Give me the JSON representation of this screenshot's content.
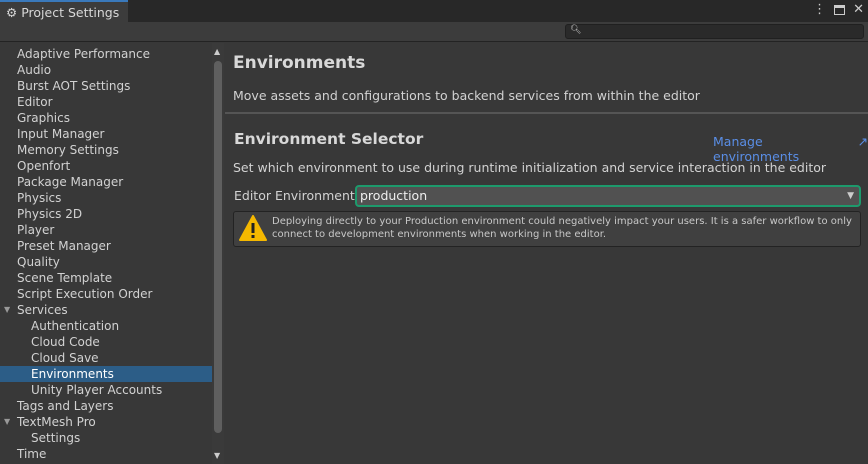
{
  "window": {
    "tab_title": "Project Settings",
    "search_placeholder": ""
  },
  "sidebar": {
    "items": [
      {
        "label": "Adaptive Performance",
        "indent": 0
      },
      {
        "label": "Audio",
        "indent": 0
      },
      {
        "label": "Burst AOT Settings",
        "indent": 0
      },
      {
        "label": "Editor",
        "indent": 0
      },
      {
        "label": "Graphics",
        "indent": 0
      },
      {
        "label": "Input Manager",
        "indent": 0
      },
      {
        "label": "Memory Settings",
        "indent": 0
      },
      {
        "label": "Openfort",
        "indent": 0
      },
      {
        "label": "Package Manager",
        "indent": 0
      },
      {
        "label": "Physics",
        "indent": 0
      },
      {
        "label": "Physics 2D",
        "indent": 0
      },
      {
        "label": "Player",
        "indent": 0
      },
      {
        "label": "Preset Manager",
        "indent": 0
      },
      {
        "label": "Quality",
        "indent": 0
      },
      {
        "label": "Scene Template",
        "indent": 0
      },
      {
        "label": "Script Execution Order",
        "indent": 0
      },
      {
        "label": "Services",
        "indent": 0,
        "expanded": true
      },
      {
        "label": "Authentication",
        "indent": 1
      },
      {
        "label": "Cloud Code",
        "indent": 1
      },
      {
        "label": "Cloud Save",
        "indent": 1
      },
      {
        "label": "Environments",
        "indent": 1,
        "selected": true
      },
      {
        "label": "Unity Player Accounts",
        "indent": 1
      },
      {
        "label": "Tags and Layers",
        "indent": 0
      },
      {
        "label": "TextMesh Pro",
        "indent": 0,
        "expanded": true
      },
      {
        "label": "Settings",
        "indent": 1
      },
      {
        "label": "Time",
        "indent": 0
      }
    ]
  },
  "main": {
    "title": "Environments",
    "description": "Move assets and configurations to backend services from within the editor",
    "section_title": "Environment Selector",
    "manage_link": "Manage environments",
    "section_description": "Set which environment to use during runtime initialization and service interaction in the editor",
    "field_label": "Editor Environment",
    "field_value": "production",
    "warning": "Deploying directly to your Production environment could negatively impact your users. It is a safer workflow to only connect to development environments when working in the editor."
  },
  "colors": {
    "accent": "#1d9a6c",
    "selection": "#2c5d87",
    "link": "#5a8ee6"
  }
}
